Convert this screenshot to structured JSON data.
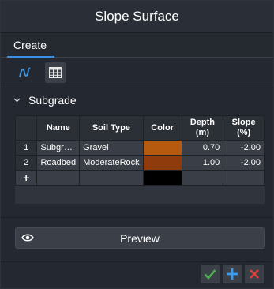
{
  "window": {
    "title": "Slope Surface"
  },
  "tabs": [
    {
      "label": "Create"
    }
  ],
  "toolbar": {
    "buttons": [
      {
        "icon": "draw-curve-icon"
      },
      {
        "icon": "table-icon"
      }
    ]
  },
  "section": {
    "title": "Subgrade"
  },
  "grid": {
    "headers": [
      "Name",
      "Soil Type",
      "Color",
      "Depth (m)",
      "Slope (%)"
    ],
    "rows": [
      {
        "index": "1",
        "name": "Subgr…",
        "soil_type": "Gravel",
        "color": "#b55a0f",
        "depth": "0.70",
        "slope": "-2.00"
      },
      {
        "index": "2",
        "name": "Roadbed",
        "soil_type": "ModerateRock",
        "color": "#8f3b0c",
        "depth": "1.00",
        "slope": "-2.00"
      }
    ],
    "new_row": {
      "index": "+",
      "color": "#000000"
    }
  },
  "preview": {
    "label": "Preview",
    "icon": "eye-icon"
  },
  "footer": {
    "ok_icon": "check-icon",
    "add_icon": "plus-icon",
    "cancel_icon": "close-icon",
    "colors": {
      "ok": "#4caf50",
      "add": "#3d9be9",
      "cancel": "#e04040"
    }
  }
}
